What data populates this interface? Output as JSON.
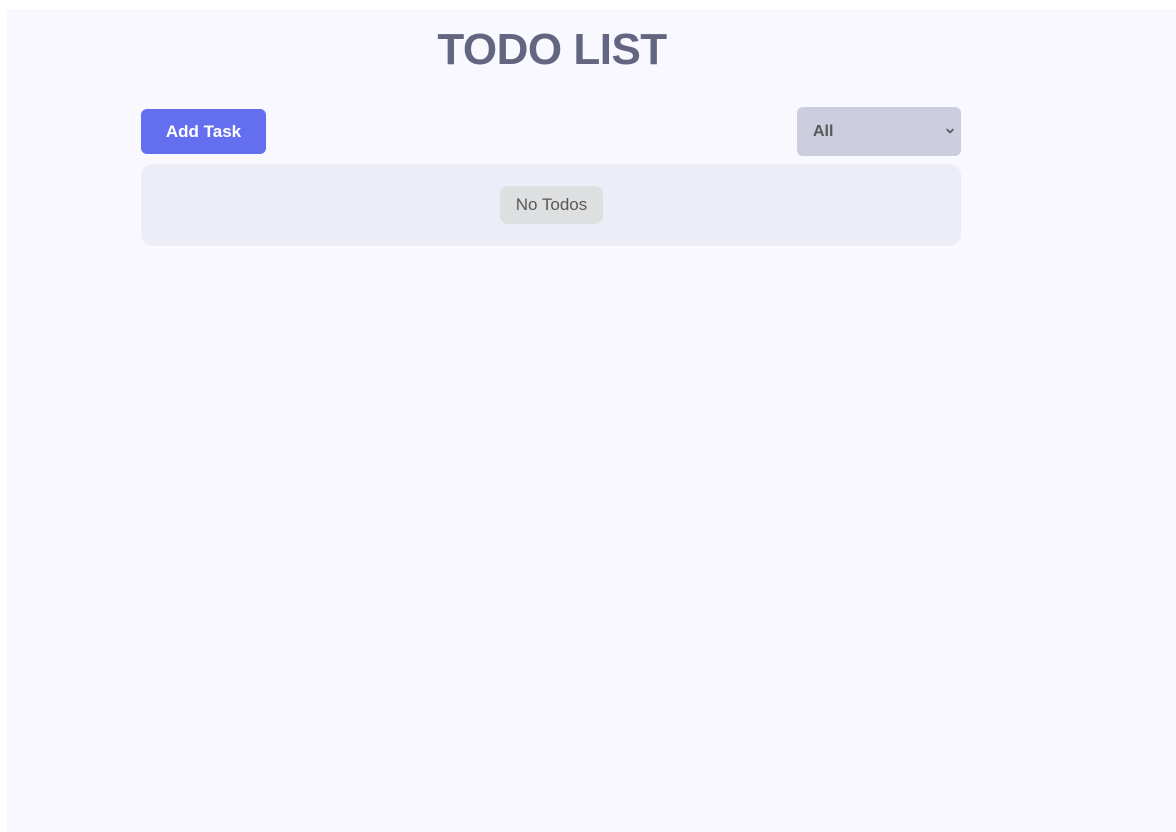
{
  "header": {
    "title": "TODO LIST"
  },
  "toolbar": {
    "add_button_label": "Add Task",
    "filter": {
      "selected": "All",
      "icon": "chevron-down-icon"
    }
  },
  "todo_list": {
    "empty_message": "No Todos",
    "items": []
  },
  "colors": {
    "page_background": "#f8f8fe",
    "title": "#646681",
    "accent": "#646ff0",
    "filter_background": "#cccdde",
    "panel_background": "#ecedf6",
    "badge_background": "#dedfe1",
    "text_muted": "#585858"
  }
}
